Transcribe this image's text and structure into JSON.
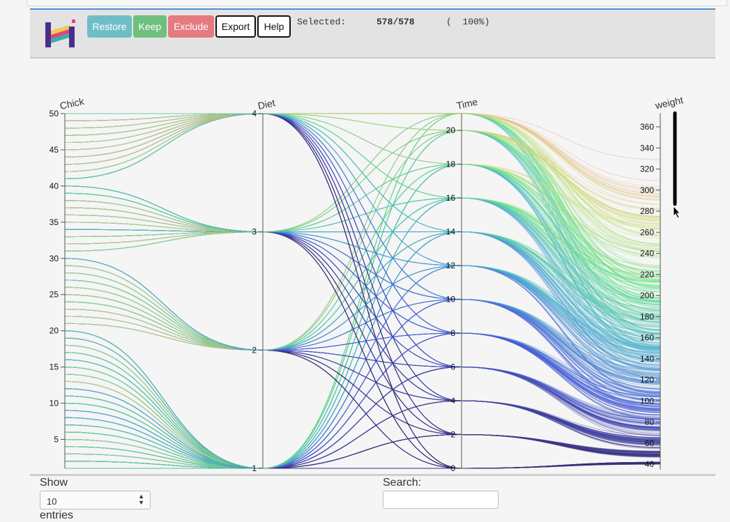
{
  "toolbar": {
    "restore": "Restore",
    "keep": "Keep",
    "exclude": "Exclude",
    "export": "Export",
    "help": "Help",
    "selected_label": "Selected:",
    "selected_count": "578/578",
    "selected_pct": "(  100%)"
  },
  "colors": {
    "header_accent": "#4a8fd6",
    "restore": "#6fbec7",
    "keep": "#6fc07e",
    "exclude": "#e57a80",
    "logo_purple": "#4b2d8a"
  },
  "chart_data": {
    "type": "parallel-coordinates",
    "axes": [
      {
        "name": "Chick",
        "min": 1,
        "max": 50,
        "ticks": [
          5,
          10,
          15,
          20,
          25,
          30,
          35,
          40,
          45,
          50
        ]
      },
      {
        "name": "Diet",
        "min": 1,
        "max": 4,
        "ticks": [
          1,
          2,
          3,
          4
        ]
      },
      {
        "name": "Time",
        "min": 0,
        "max": 21,
        "ticks": [
          0,
          2,
          4,
          6,
          8,
          10,
          12,
          14,
          16,
          18,
          20
        ]
      },
      {
        "name": "weight",
        "min": 35,
        "max": 373,
        "ticks": [
          40,
          60,
          80,
          100,
          120,
          140,
          160,
          180,
          200,
          220,
          240,
          260,
          280,
          300,
          320,
          340,
          360
        ]
      }
    ],
    "diet_by_chick": [
      [
        1,
        20
      ],
      [
        21,
        30
      ],
      [
        31,
        40
      ],
      [
        41,
        50
      ]
    ],
    "time_points": [
      0,
      2,
      4,
      6,
      8,
      10,
      12,
      14,
      16,
      18,
      20,
      21
    ],
    "weight_mean_by_time": [
      41,
      49,
      60,
      74,
      91,
      107,
      130,
      147,
      168,
      188,
      210,
      219
    ],
    "weight_spread_by_time": [
      2,
      4,
      6,
      10,
      14,
      18,
      24,
      28,
      34,
      40,
      46,
      52
    ],
    "color_scale": [
      "#3a2a6e",
      "#4a5fd6",
      "#4cb0d0",
      "#5fe08a",
      "#c8e27a",
      "#f2b08a",
      "#f08080"
    ],
    "brush": {
      "axis": "weight",
      "from": 288,
      "to": 373
    }
  },
  "table": {
    "show_label": "Show",
    "page_size": "10",
    "entries_label": "entries",
    "search_label": "Search:",
    "search_value": ""
  }
}
